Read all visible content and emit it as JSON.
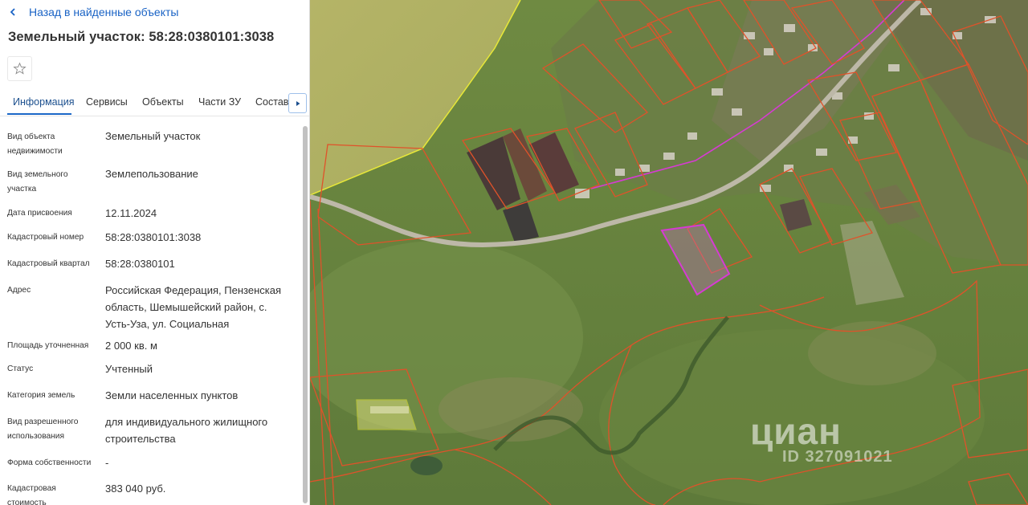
{
  "nav": {
    "back_label": "Назад в найденные объекты"
  },
  "page": {
    "title": "Земельный участок: 58:28:0380101:3038"
  },
  "tabs": [
    {
      "label": "Информация",
      "active": true
    },
    {
      "label": "Сервисы",
      "active": false
    },
    {
      "label": "Объекты",
      "active": false
    },
    {
      "label": "Части ЗУ",
      "active": false
    },
    {
      "label": "Состав",
      "active": false
    }
  ],
  "info": [
    {
      "label": "Вид объекта недвижимости",
      "value": "Земельный участок"
    },
    {
      "label": "Вид земельного участка",
      "value": "Землепользование"
    },
    {
      "label": "Дата присвоения",
      "value": "12.11.2024"
    },
    {
      "label": "Кадастровый номер",
      "value": "58:28:0380101:3038"
    },
    {
      "label": "Кадастровый квартал",
      "value": "58:28:0380101"
    },
    {
      "label": "Адрес",
      "value": "Российская Федерация, Пензенская область, Шемышейский район, с. Усть-Уза, ул. Социальная"
    },
    {
      "label": "Площадь уточненная",
      "value": "2 000 кв. м"
    },
    {
      "label": "Статус",
      "value": "Учтенный"
    },
    {
      "label": "Категория земель",
      "value": "Земли населенных пунктов"
    },
    {
      "label": "Вид разрешенного использования",
      "value": "для индивидуального жилищного строительства"
    },
    {
      "label": "Форма собственности",
      "value": "-"
    },
    {
      "label": "Кадастровая стоимость",
      "value": "383 040 руб."
    }
  ],
  "map": {
    "watermark": "циан",
    "watermark_id": "ID 327091021",
    "colors": {
      "parcel_border": "#e0522a",
      "selected_parcel": "#d63bd3",
      "field_border": "#e8e838",
      "link": "#1a63c5",
      "tab_active": "#1b67c7"
    }
  },
  "icons": {
    "back": "chevron-left-icon",
    "favorite": "star-outline-icon",
    "tab_scroll": "triangle-right-icon"
  }
}
